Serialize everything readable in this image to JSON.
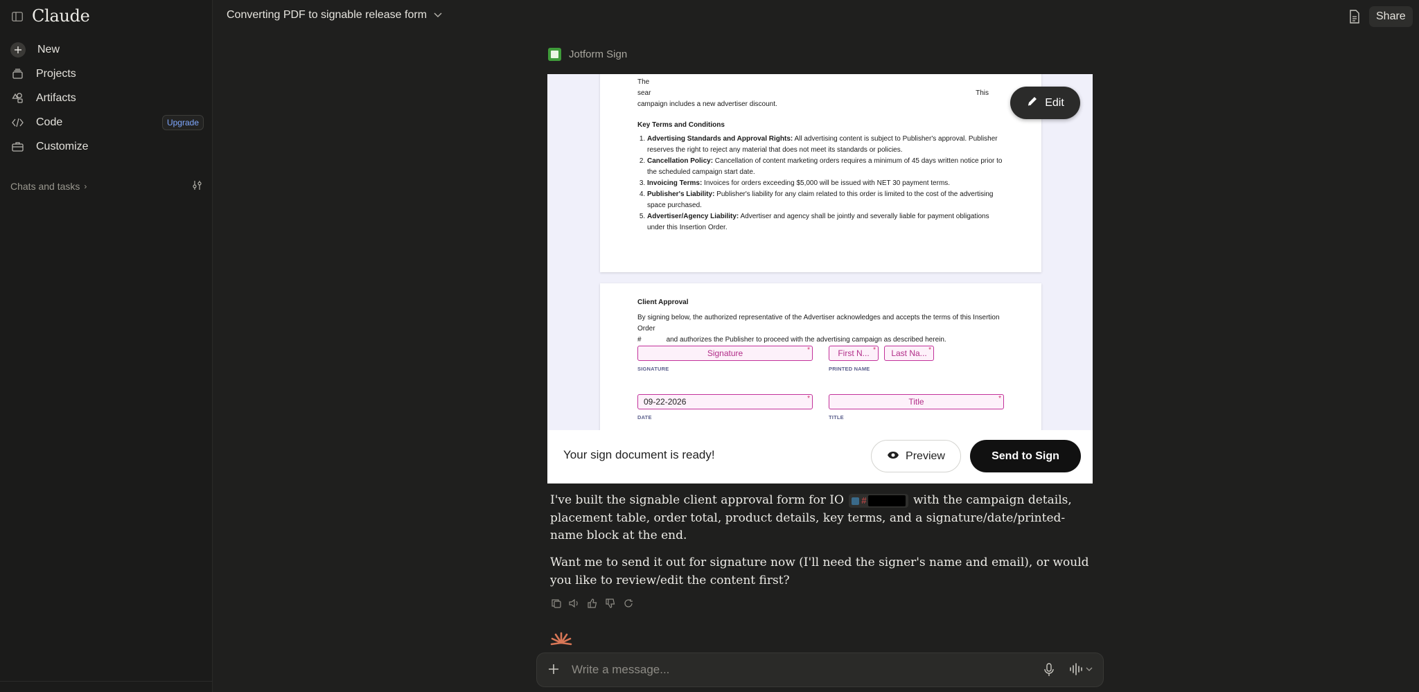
{
  "app": {
    "name": "Claude"
  },
  "sidebar": {
    "items": [
      {
        "label": "New",
        "icon": "plus-icon"
      },
      {
        "label": "Projects",
        "icon": "stack-icon"
      },
      {
        "label": "Artifacts",
        "icon": "shapes-icon"
      },
      {
        "label": "Code",
        "icon": "code-icon",
        "badge": "Upgrade"
      },
      {
        "label": "Customize",
        "icon": "briefcase-icon"
      }
    ],
    "chats_header": "Chats and tasks"
  },
  "header": {
    "title": "Converting PDF to signable release form",
    "share_label": "Share"
  },
  "tool": {
    "name": "Jotform Sign",
    "edit_label": "Edit",
    "ready_text": "Your sign document is ready!",
    "preview_label": "Preview",
    "send_label": "Send to Sign"
  },
  "document": {
    "page1": {
      "intro_line1_start": "The",
      "intro_line2_start": "sear",
      "intro_line1_end": "This",
      "intro_line3": "campaign includes a new advertiser discount.",
      "terms_heading": "Key Terms and Conditions",
      "terms": [
        {
          "title": "Advertising Standards and Approval Rights:",
          "text": " All advertising content is subject to Publisher's approval. Publisher reserves the right to reject any material that does not meet its standards or policies."
        },
        {
          "title": "Cancellation Policy:",
          "text": " Cancellation of content marketing orders requires a minimum of 45 days written notice prior to the scheduled campaign start date."
        },
        {
          "title": "Invoicing Terms:",
          "text": " Invoices for orders exceeding $5,000 will be issued with NET 30 payment terms."
        },
        {
          "title": "Publisher's Liability:",
          "text": " Publisher's liability for any claim related to this order is limited to the cost of the advertising space purchased."
        },
        {
          "title": "Advertiser/Agency Liability:",
          "text": " Advertiser and agency shall be jointly and severally liable for payment obligations under this Insertion Order."
        }
      ]
    },
    "page2": {
      "heading": "Client Approval",
      "para1": "By signing below, the authorized representative of the Advertiser acknowledges and accepts the terms of this Insertion Order",
      "para2_start": "#",
      "para2_end": "and authorizes the Publisher to proceed with the advertising campaign as described herein.",
      "fields": {
        "signature": "Signature",
        "first_name": "First N...",
        "last_name": "Last Na...",
        "date_value": "09-22-2026",
        "title": "Title"
      },
      "labels": {
        "signature": "SIGNATURE",
        "printed_name": "PRINTED NAME",
        "date": "DATE",
        "title": "TITLE"
      },
      "required_mark": "*"
    }
  },
  "message": {
    "p1_before": "I've built the signable client approval form for IO",
    "p1_chip_hash": "#",
    "p1_after": "with the campaign details, placement table, order total, product details, key terms, and a signature/date/printed-name block at the end.",
    "p2": "Want me to send it out for signature now (I'll need the signer's name and email), or would you like to review/edit the content first?"
  },
  "composer": {
    "placeholder": "Write a message..."
  }
}
